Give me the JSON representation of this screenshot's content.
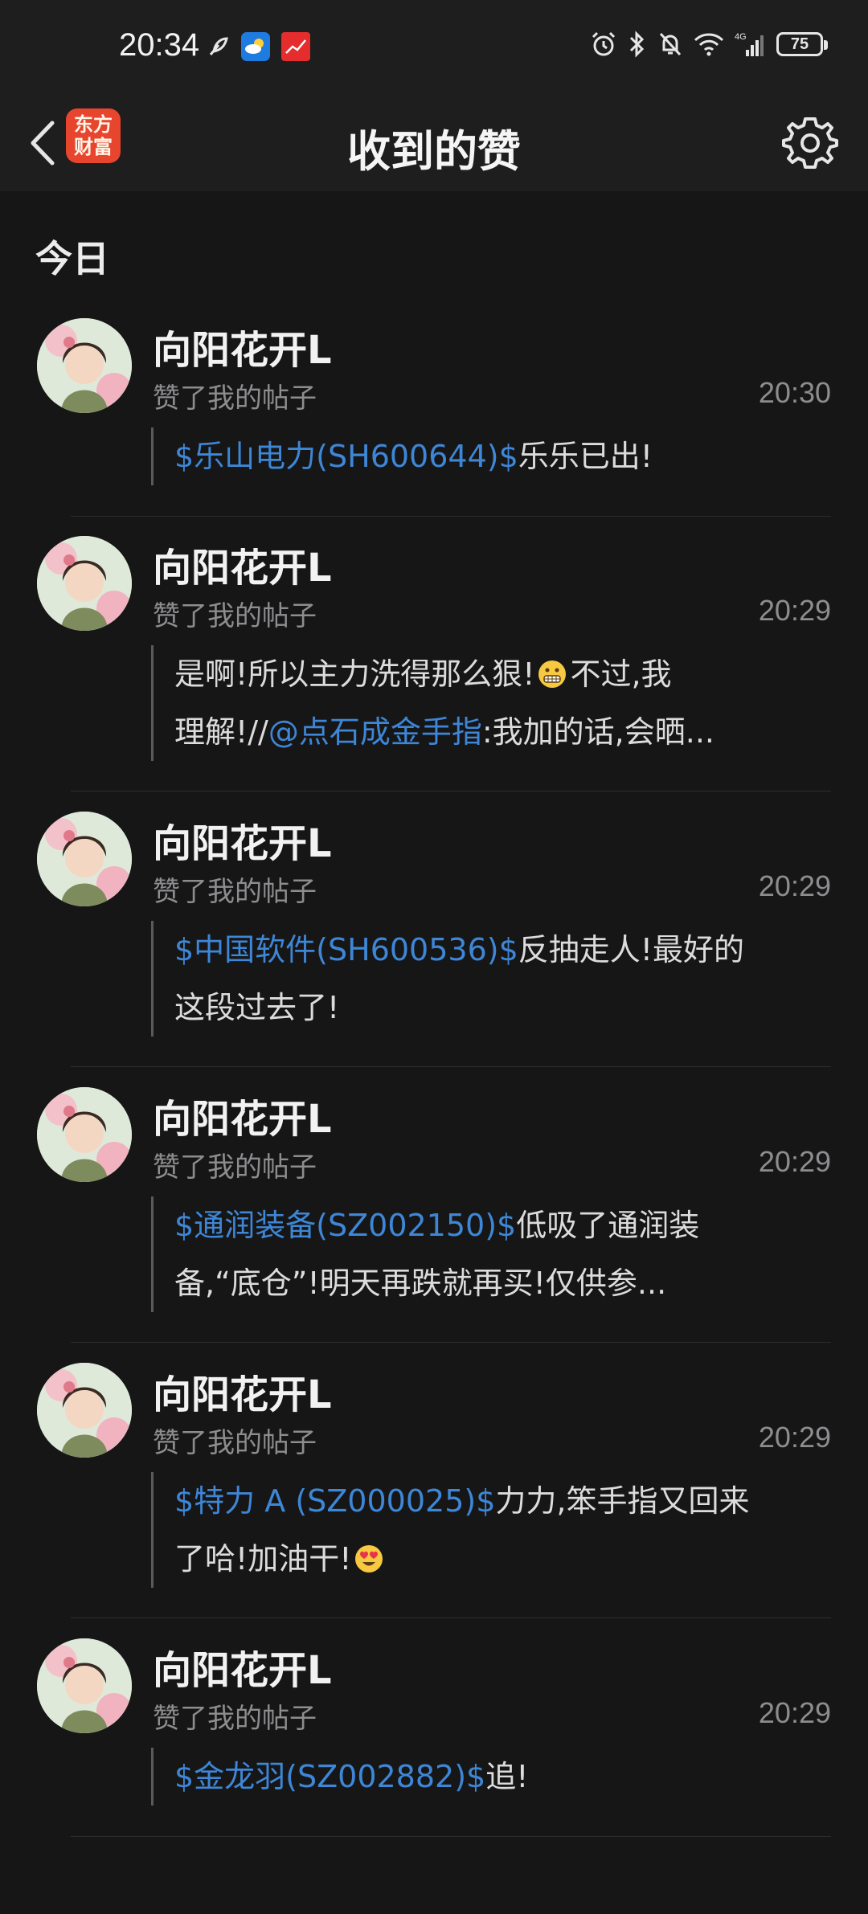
{
  "status_bar": {
    "time": "20:34",
    "battery": "75",
    "network": "4G"
  },
  "header": {
    "title": "收到的赞",
    "logo_line1": "东方",
    "logo_line2": "财富"
  },
  "section": {
    "label": "今日"
  },
  "colors": {
    "background": "#161617",
    "bar": "#1e1e1f",
    "link": "#3e86d6",
    "muted": "#8d8d8f",
    "logo": "#e8452e"
  },
  "items": [
    {
      "username": "向阳花开L",
      "action": "赞了我的帖子",
      "time": "20:30",
      "line1_stock": "$乐山电力(SH600644)$",
      "line1_text": "乐乐已出!",
      "line2": ""
    },
    {
      "username": "向阳花开L",
      "action": "赞了我的帖子",
      "time": "20:29",
      "line1_text": "是啊!所以主力洗得那么狠!",
      "line1_after_emoji": "不过,我",
      "line2_pre": "理解!//",
      "line2_mention": "@点石成金手指",
      "line2_text": ":我加的话,会晒..."
    },
    {
      "username": "向阳花开L",
      "action": "赞了我的帖子",
      "time": "20:29",
      "line1_stock": "$中国软件(SH600536)$",
      "line1_text": "反抽走人!最好的",
      "line2": "这段过去了!"
    },
    {
      "username": "向阳花开L",
      "action": "赞了我的帖子",
      "time": "20:29",
      "line1_stock": "$通润装备(SZ002150)$",
      "line1_text": "低吸了通润装",
      "line2": "备,“底仓”!明天再跌就再买!仅供参..."
    },
    {
      "username": "向阳花开L",
      "action": "赞了我的帖子",
      "time": "20:29",
      "line1_stock": "$特力 A (SZ000025)$",
      "line1_text": "力力,笨手指又回来",
      "line2": "了哈!加油干!"
    },
    {
      "username": "向阳花开L",
      "action": "赞了我的帖子",
      "time": "20:29",
      "line1_stock": "$金龙羽(SZ002882)$",
      "line1_text": "追!",
      "line2": ""
    }
  ]
}
